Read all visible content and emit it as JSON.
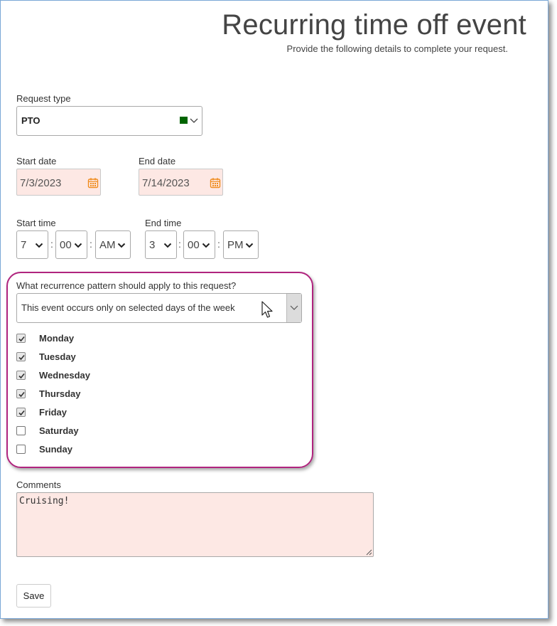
{
  "header": {
    "title": "Recurring time off event",
    "subtitle": "Provide the following details to complete your request."
  },
  "request_type": {
    "label": "Request type",
    "value": "PTO",
    "color": "#006400"
  },
  "start_date": {
    "label": "Start date",
    "value": "7/3/2023"
  },
  "end_date": {
    "label": "End date",
    "value": "7/14/2023"
  },
  "start_time": {
    "label": "Start time",
    "hour": "7",
    "minute": "00",
    "ampm": "AM"
  },
  "end_time": {
    "label": "End time",
    "hour": "3",
    "minute": "00",
    "ampm": "PM"
  },
  "time_separator": ":",
  "recurrence": {
    "label": "What recurrence pattern should apply to this request?",
    "value": "This event occurs only on selected days of the week",
    "highlight_color": "#b0247e",
    "days": [
      {
        "label": "Monday",
        "checked": true
      },
      {
        "label": "Tuesday",
        "checked": true
      },
      {
        "label": "Wednesday",
        "checked": true
      },
      {
        "label": "Thursday",
        "checked": true
      },
      {
        "label": "Friday",
        "checked": true
      },
      {
        "label": "Saturday",
        "checked": false
      },
      {
        "label": "Sunday",
        "checked": false
      }
    ]
  },
  "comments": {
    "label": "Comments",
    "value": "Cruising!"
  },
  "actions": {
    "save_label": "Save"
  },
  "colors": {
    "field_error_bg": "#fde8e4",
    "calendar_icon": "#f08c1e",
    "frame_border": "#7aa7d6"
  },
  "icons": [
    "calendar-icon",
    "chevron-down-icon",
    "checkmark-icon",
    "mouse-cursor-icon",
    "resize-handle-icon"
  ]
}
